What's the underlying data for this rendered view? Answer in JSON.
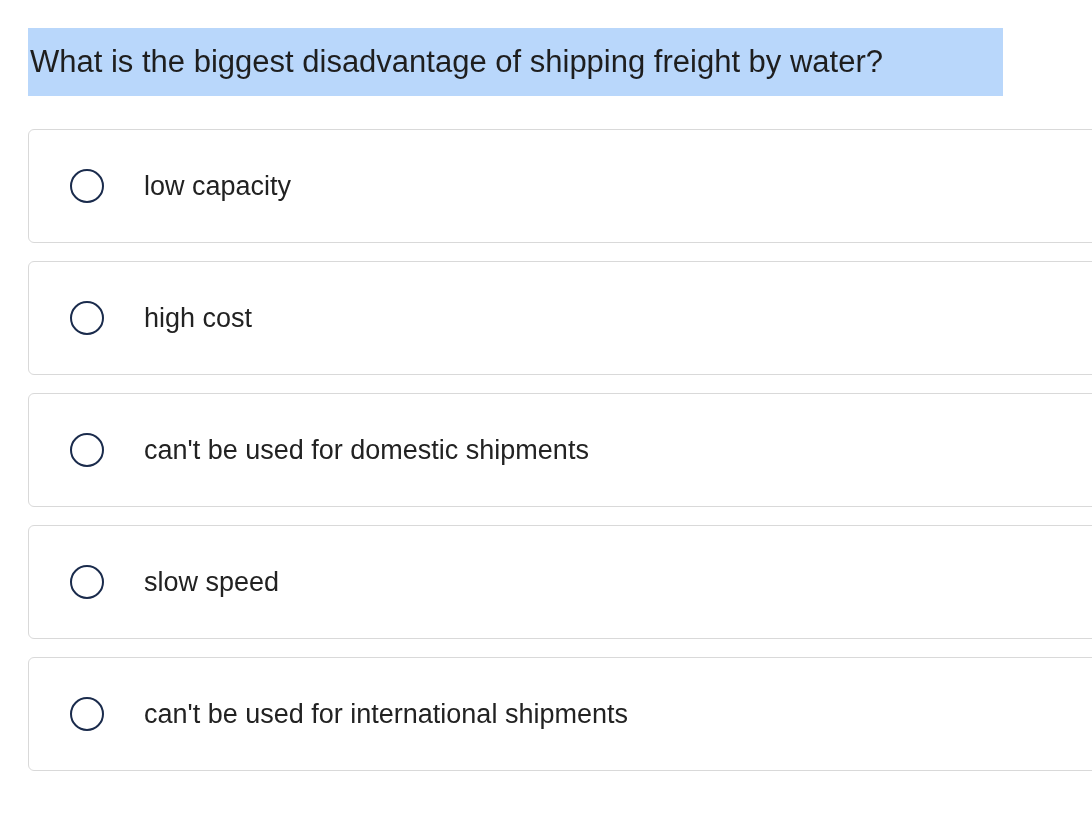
{
  "question": {
    "text": "What is the biggest disadvantage of shipping freight by water?",
    "highlighted": true
  },
  "options": [
    {
      "label": "low capacity",
      "selected": false
    },
    {
      "label": "high cost",
      "selected": false
    },
    {
      "label": "can't be used for domestic shipments",
      "selected": false
    },
    {
      "label": "slow speed",
      "selected": false
    },
    {
      "label": "can't be used for international shipments",
      "selected": false
    }
  ]
}
